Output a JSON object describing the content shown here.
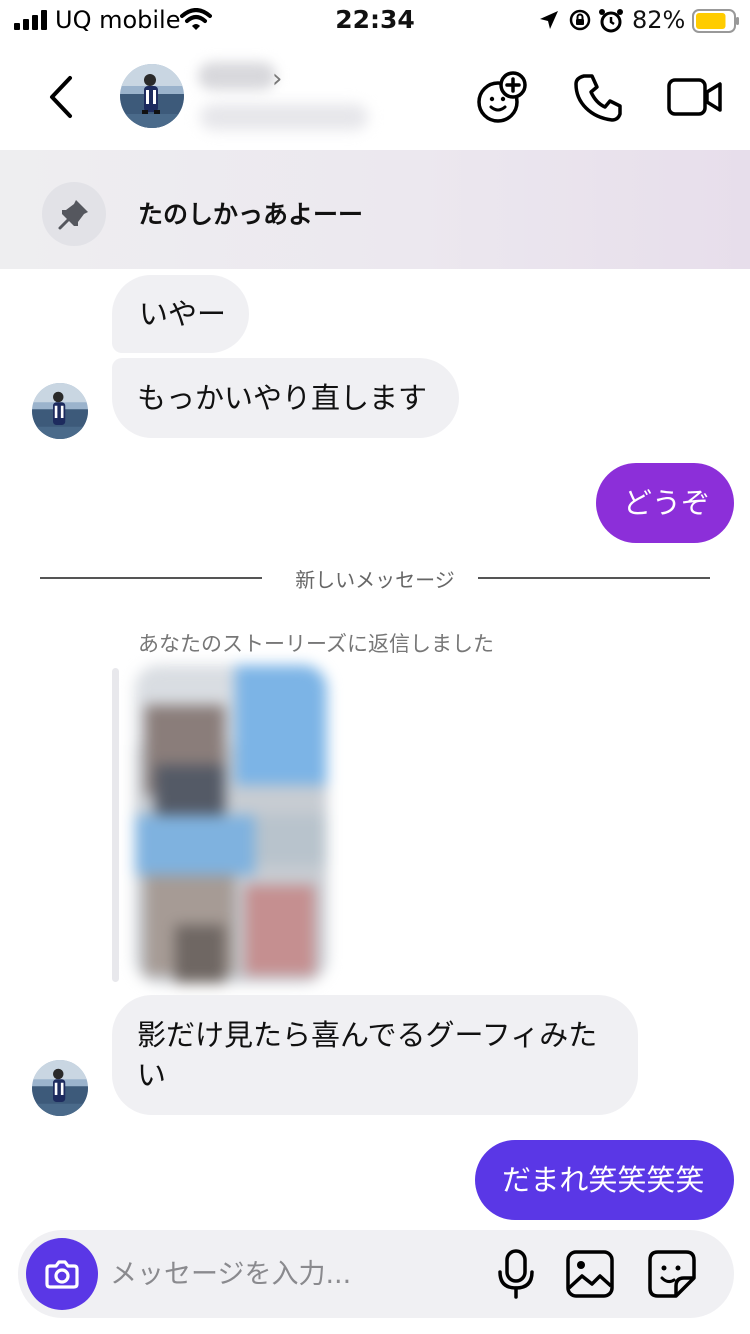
{
  "status_bar": {
    "carrier": "UQ mobile",
    "time": "22:34",
    "battery_percent": "82%",
    "battery_level": 0.82,
    "battery_color": "#ffcc00",
    "icons": [
      "signal-icon",
      "wifi-icon",
      "location-arrow-icon",
      "orientation-lock-icon",
      "alarm-icon",
      "battery-icon"
    ]
  },
  "header": {
    "icons": [
      "back-chevron-icon",
      "effects-smiley-plus-icon",
      "phone-icon",
      "video-camera-icon"
    ]
  },
  "pinned": {
    "text": "たのしかっあよーー",
    "icon": "pin-icon"
  },
  "messages": {
    "m1": "いやー",
    "m2": "もっかいやり直します",
    "m3": "どうぞ",
    "divider": "新しいメッセージ",
    "story_reply_label": "あなたのストーリーズに返信しました",
    "m4": "影だけ見たら喜んでるグーフィみたい",
    "m5": "だまれ笑笑笑笑"
  },
  "composer": {
    "placeholder": "メッセージを入力...",
    "value": "",
    "icons": [
      "camera-icon",
      "microphone-icon",
      "gallery-icon",
      "sticker-icon"
    ]
  },
  "colors": {
    "outgoing_purple": "#8c2fd9",
    "outgoing_indigo": "#5a37e6",
    "incoming_bubble": "#f0f0f3",
    "accent": "#5a37e6"
  }
}
